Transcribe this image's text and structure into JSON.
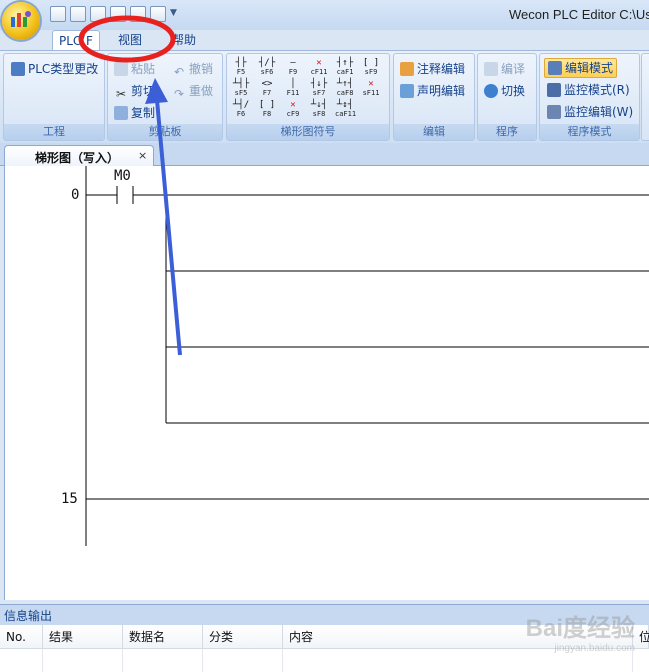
{
  "window": {
    "title": "Wecon PLC Editor  C:\\Us"
  },
  "tabs": [
    {
      "label": "PLC(F"
    },
    {
      "label": "视图"
    },
    {
      "label": "帮助"
    }
  ],
  "ribbon": {
    "project": {
      "plc_type_change": "PLC类型更改",
      "group": "工程"
    },
    "clipboard": {
      "paste": "粘贴",
      "cut": "剪切",
      "copy": "复制",
      "group": "剪贴板"
    },
    "undo": {
      "undo": "撤销",
      "redo": "重做"
    },
    "ladder": {
      "row1": [
        "F5",
        "sF6",
        "F9",
        "cF11",
        "caF1",
        "sF9"
      ],
      "row2": [
        "sF5",
        "F7",
        "F11",
        "sF7",
        "caF8",
        "sF11"
      ],
      "row3": [
        "F6",
        "F8",
        "cF9",
        "sF8",
        "caF11"
      ],
      "group": "梯形图符号"
    },
    "edit": {
      "comment_edit": "注释编辑",
      "statement_edit": "声明编辑",
      "group": "编辑"
    },
    "program": {
      "compile": "编译",
      "switch": "切换",
      "group": "程序"
    },
    "mode": {
      "edit_mode": "编辑模式",
      "monitor_mode": "监控模式(R)",
      "monitor_edit": "监控编辑(W)",
      "group": "程序模式"
    }
  },
  "document": {
    "tab_label": "梯形图（写入）",
    "close": "×"
  },
  "ladder": {
    "rung_start": "0",
    "rung_next": "15",
    "contact_label": "M0"
  },
  "info": {
    "title": "信息输出",
    "columns": [
      "No.",
      "结果",
      "数据名",
      "分类",
      "内容",
      "位"
    ]
  },
  "watermark": {
    "text": "Bai度经验",
    "sub": "jingyan.baidu.com"
  },
  "colors": {
    "annotation_circle": "#e8201e",
    "annotation_arrow": "#3c5fd8",
    "ribbon_bg": "#dbe6f4"
  }
}
